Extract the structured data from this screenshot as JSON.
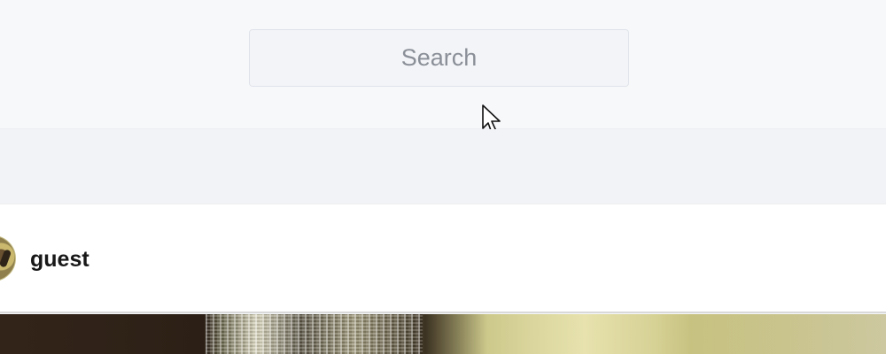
{
  "search": {
    "placeholder": "Search",
    "value": ""
  },
  "cursor": {
    "icon": "mouse-pointer-icon"
  },
  "profile": {
    "username": "guest",
    "avatar_icon": "avatar-image"
  },
  "feed": {
    "image_icon": "post-image"
  },
  "colors": {
    "background": "#f6f7f9",
    "search_border": "#dfe3ea",
    "username": "#181818"
  }
}
